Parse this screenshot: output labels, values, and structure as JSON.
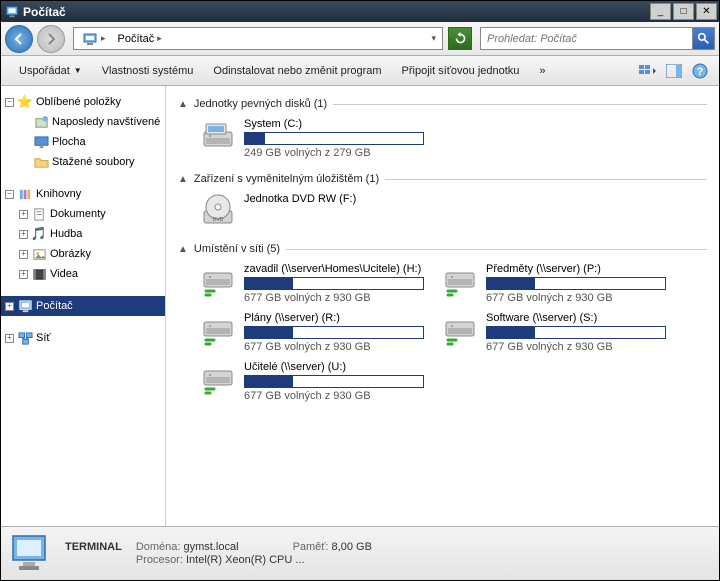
{
  "window": {
    "title": "Počítač"
  },
  "nav": {
    "breadcrumb": "Počítač",
    "search_placeholder": "Prohledat: Počítač"
  },
  "toolbar": {
    "organize": "Uspořádat",
    "props": "Vlastnosti systému",
    "uninstall": "Odinstalovat nebo změnit program",
    "mapdrive": "Připojit síťovou jednotku",
    "more": "»"
  },
  "tree": {
    "favorites": {
      "label": "Oblíbené položky",
      "items": [
        "Naposledy navštívené",
        "Plocha",
        "Stažené soubory"
      ]
    },
    "libraries": {
      "label": "Knihovny",
      "items": [
        "Dokumenty",
        "Hudba",
        "Obrázky",
        "Videa"
      ]
    },
    "computer": {
      "label": "Počítač"
    },
    "network": {
      "label": "Síť"
    }
  },
  "sections": {
    "hdd": {
      "title": "Jednotky pevných disků (1)",
      "drives": [
        {
          "name": "System (C:)",
          "free": "249 GB volných z 279 GB",
          "fill": 11
        }
      ]
    },
    "removable": {
      "title": "Zařízení s vyměnitelným úložištěm (1)",
      "drives": [
        {
          "name": "Jednotka DVD RW (F:)",
          "type": "dvd"
        }
      ]
    },
    "network": {
      "title": "Umístění v síti (5)",
      "drives": [
        {
          "name": "zavadil (\\\\server\\Homes\\Ucitele) (H:)",
          "free": "677 GB volných z 930 GB",
          "fill": 27
        },
        {
          "name": "Předměty (\\\\server) (P:)",
          "free": "677 GB volných z 930 GB",
          "fill": 27
        },
        {
          "name": "Plány (\\\\server) (R:)",
          "free": "677 GB volných z 930 GB",
          "fill": 27
        },
        {
          "name": "Software (\\\\server) (S:)",
          "free": "677 GB volných z 930 GB",
          "fill": 27
        },
        {
          "name": "Učitelé (\\\\server) (U:)",
          "free": "677 GB volných z 930 GB",
          "fill": 27
        }
      ]
    }
  },
  "status": {
    "name": "TERMINAL",
    "domain_label": "Doména:",
    "domain": "gymst.local",
    "cpu_label": "Procesor:",
    "cpu": "Intel(R) Xeon(R) CPU    ...",
    "mem_label": "Paměť:",
    "mem": "8,00 GB"
  }
}
